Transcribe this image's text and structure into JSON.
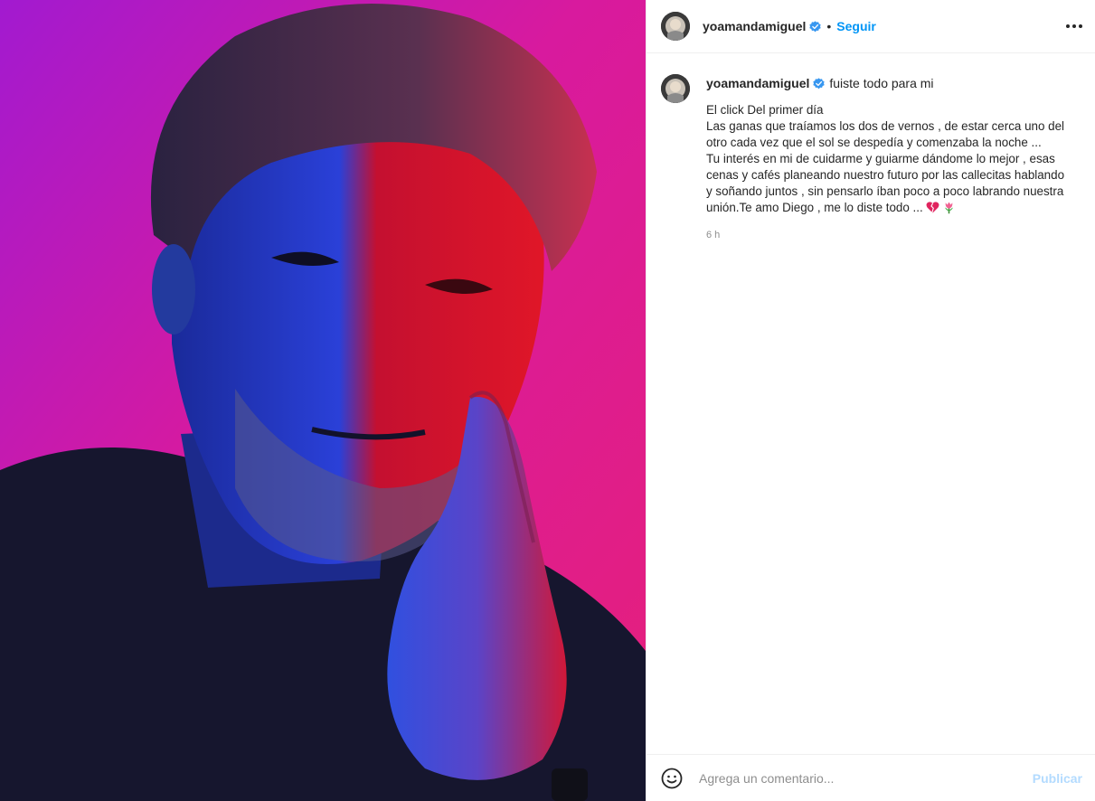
{
  "post": {
    "username": "yoamandamiguel",
    "separator": "•",
    "follow_label": "Seguir",
    "more_icon": "more-options-icon",
    "verified_icon": "verified-badge-icon",
    "photo_subject": "portrait-photo"
  },
  "caption": {
    "username": "yoamandamiguel",
    "title": "fuiste todo para mi",
    "text": "El click Del primer día\nLas ganas que traíamos los dos de vernos , de estar cerca uno del otro cada vez que el sol se despedía y comenzaba la noche ...\nTu interés en mi de cuidarme y guiarme dándome lo mejor , esas cenas y cafés planeando nuestro futuro por las callecitas hablando y soñando juntos , sin pensarlo íban poco a poco labrando nuestra unión.Te amo Diego , me lo diste todo ...",
    "emojis": [
      "broken-heart-icon",
      "tulip-icon"
    ],
    "time": "6 h"
  },
  "comment_box": {
    "placeholder": "Agrega un comentario...",
    "publish_label": "Publicar",
    "emoji_icon": "smiley-icon"
  },
  "colors": {
    "link": "#0095f6",
    "publish_disabled": "#b3dbff",
    "border": "#efefef",
    "muted": "#8e8e8e"
  }
}
